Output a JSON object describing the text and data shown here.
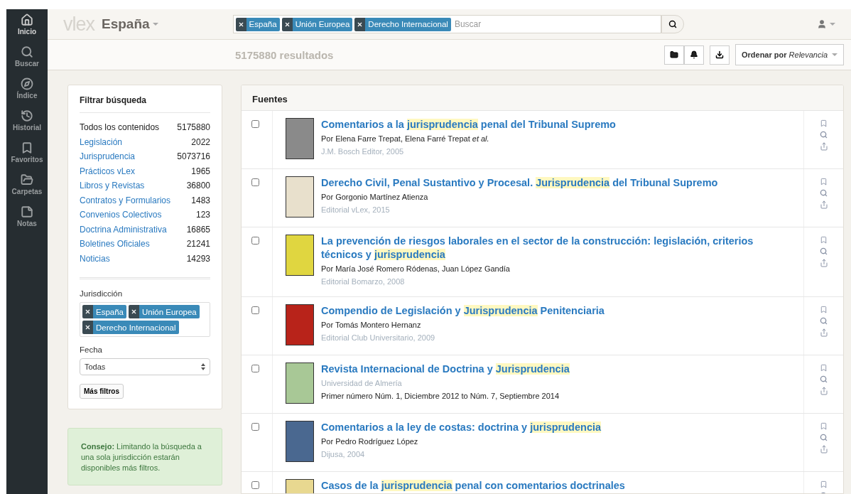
{
  "sidebar": {
    "items": [
      {
        "label": "Inicio",
        "selected": true
      },
      {
        "label": "Buscar",
        "selected": false
      },
      {
        "label": "Índice",
        "selected": false
      },
      {
        "label": "Historial",
        "selected": false
      },
      {
        "label": "Favoritos",
        "selected": false
      },
      {
        "label": "Carpetas",
        "selected": false
      },
      {
        "label": "Notas",
        "selected": false
      }
    ]
  },
  "header": {
    "logo": "vlex",
    "country": "España",
    "search": {
      "tags": [
        "España",
        "Unión Europea",
        "Derecho Internacional"
      ],
      "placeholder": "Buscar"
    }
  },
  "toolbar": {
    "results": "5175880 resultados",
    "sort": "Ordenar por *Relevancia*"
  },
  "filters": {
    "title": "Filtrar búsqueda",
    "items": [
      {
        "label": "Todos los contenidos",
        "count": "5175880",
        "selected": true
      },
      {
        "label": "Legislación",
        "count": "2022",
        "selected": false
      },
      {
        "label": "Jurisprudencia",
        "count": "5073716",
        "selected": false
      },
      {
        "label": "Prácticos vLex",
        "count": "1965",
        "selected": false
      },
      {
        "label": "Libros y Revistas",
        "count": "36800",
        "selected": false
      },
      {
        "label": "Contratos y Formularios",
        "count": "1483",
        "selected": false
      },
      {
        "label": "Convenios Colectivos",
        "count": "123",
        "selected": false
      },
      {
        "label": "Doctrina Administrativa",
        "count": "16865",
        "selected": false
      },
      {
        "label": "Boletines Oficiales",
        "count": "21241",
        "selected": false
      },
      {
        "label": "Noticias",
        "count": "14293",
        "selected": false
      }
    ],
    "jurisdiction_label": "Jurisdicción",
    "jurisdiction_tags": [
      "España",
      "Unión Europea",
      "Derecho Internacional"
    ],
    "date_label": "Fecha",
    "date_value": "Todas",
    "more_button": "Más filtros"
  },
  "tip": "**Consejo:** Limitando la búsqueda a una sola jurisdicción estarán disponibles más filtros.",
  "results": {
    "title": "Fuentes",
    "items": [
      {
        "checked": false,
        "color": "#8a8a8a",
        "title": [
          {
            "text": "Comentarios a la ",
            "highlight": false
          },
          {
            "text": "jurisprudencia",
            "highlight": true
          },
          {
            "text": " penal del Tribunal Supremo",
            "highlight": false
          }
        ],
        "lines": [
          {
            "text": "Por Elena Farre Trepat, Elena Farré Trepat *et al.*",
            "muted": false
          },
          {
            "text": "J.M. Bosch Editor, 2005",
            "muted": true
          }
        ]
      },
      {
        "checked": false,
        "color": "#e8e0cc",
        "title": [
          {
            "text": "Derecho Civil, Penal Sustantivo y Procesal. ",
            "highlight": false
          },
          {
            "text": "Jurisprudencia",
            "highlight": true
          },
          {
            "text": " del Tribunal Supremo",
            "highlight": false
          }
        ],
        "lines": [
          {
            "text": "Por Gorgonio Martínez Atienza",
            "muted": false
          },
          {
            "text": "Editorial vLex, 2015",
            "muted": true
          }
        ]
      },
      {
        "checked": false,
        "color": "#e0d640",
        "title": [
          {
            "text": "La prevención de riesgos laborales en el sector de la construcción: legislación, criterios técnicos y ",
            "highlight": false
          },
          {
            "text": "jurisprudencia",
            "highlight": true
          }
        ],
        "lines": [
          {
            "text": "Por María José Romero Ródenas, Juan López Gandía",
            "muted": false
          },
          {
            "text": "Editorial Bomarzo, 2008",
            "muted": true
          }
        ]
      },
      {
        "checked": false,
        "color": "#b8231a",
        "title": [
          {
            "text": "Compendio de Legislación y ",
            "highlight": false
          },
          {
            "text": "Jurisprudencia",
            "highlight": true
          },
          {
            "text": " Penitenciaria",
            "highlight": false
          }
        ],
        "lines": [
          {
            "text": "Por Tomás Montero Hernanz",
            "muted": false
          },
          {
            "text": "Editorial Club Universitario, 2009",
            "muted": true
          }
        ]
      },
      {
        "checked": false,
        "color": "#a8c896",
        "title": [
          {
            "text": "Revista Internacional de Doctrina y ",
            "highlight": false
          },
          {
            "text": "Jurisprudencia",
            "highlight": true
          }
        ],
        "lines": [
          {
            "text": "Universidad de Almería",
            "muted": true
          },
          {
            "text": "Primer número Núm. 1, Diciembre 2012 to Núm. 7, Septiembre 2014",
            "muted": false
          }
        ]
      },
      {
        "checked": false,
        "color": "#4a6890",
        "title": [
          {
            "text": "Comentarios a la ley de costas: doctrina y ",
            "highlight": false
          },
          {
            "text": "jurisprudencia",
            "highlight": true
          }
        ],
        "lines": [
          {
            "text": "Por Pedro Rodríguez López",
            "muted": false
          },
          {
            "text": "Dijusa, 2004",
            "muted": true
          }
        ]
      },
      {
        "checked": false,
        "color": "#e8d890",
        "title": [
          {
            "text": "Casos de la ",
            "highlight": false
          },
          {
            "text": "jurisprudencia",
            "highlight": true
          },
          {
            "text": " penal con comentarios doctrinales",
            "highlight": false
          }
        ]
      }
    ]
  }
}
